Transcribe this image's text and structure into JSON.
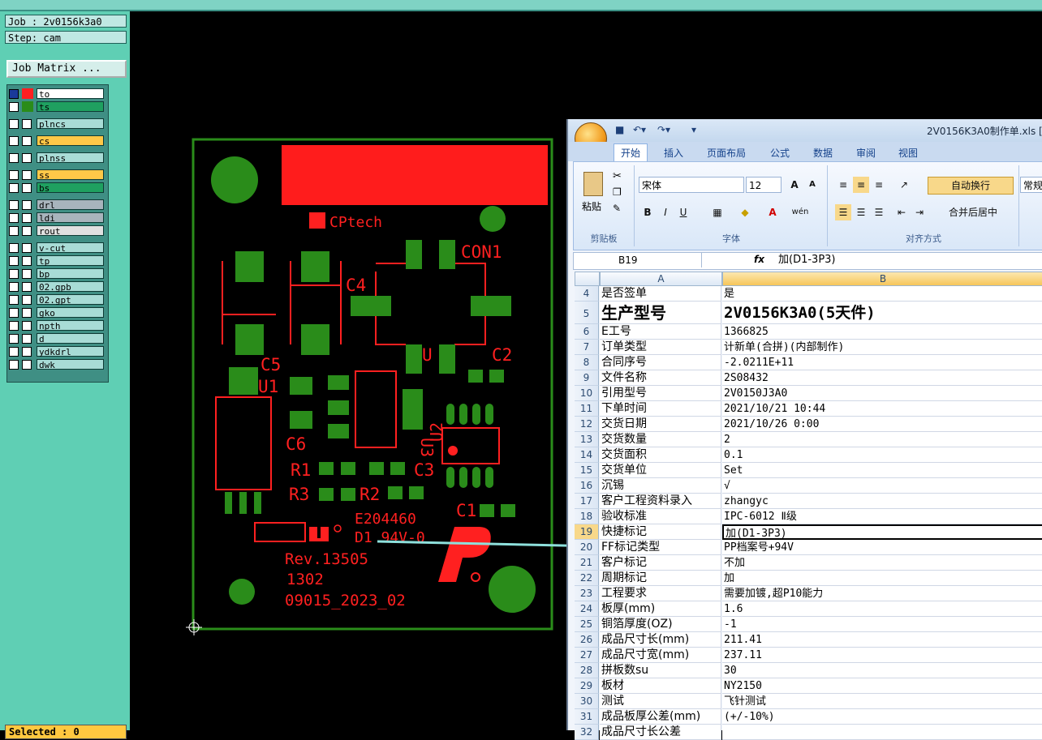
{
  "left_panel": {
    "job": "Job : 2v0156k3a0",
    "step": "Step: cam",
    "job_matrix_button": "Job Matrix ...",
    "selected": "Selected : 0",
    "layers": [
      {
        "name": "to",
        "color": "#ffffff"
      },
      {
        "name": "ts",
        "color": "#1fa060"
      },
      {
        "name": "plncs",
        "color": "#a8dcd6"
      },
      {
        "name": "cs",
        "color": "#ffc848"
      },
      {
        "name": "plnss",
        "color": "#a8dcd6"
      },
      {
        "name": "ss",
        "color": "#ffc848"
      },
      {
        "name": "bs",
        "color": "#1fa060"
      },
      {
        "name": "drl",
        "color": "#a8b4bc"
      },
      {
        "name": "ldi",
        "color": "#a8b4bc"
      },
      {
        "name": "rout",
        "color": "#e0e0e0"
      },
      {
        "name": "v-cut",
        "color": "#a8dcd6"
      },
      {
        "name": "tp",
        "color": "#a8dcd6"
      },
      {
        "name": "bp",
        "color": "#a8dcd6"
      },
      {
        "name": "02.gpb",
        "color": "#a8dcd6"
      },
      {
        "name": "02.gpt",
        "color": "#a8dcd6"
      },
      {
        "name": "gko",
        "color": "#a8dcd6"
      },
      {
        "name": "npth",
        "color": "#a8dcd6"
      },
      {
        "name": "d",
        "color": "#a8dcd6"
      },
      {
        "name": "ydkdrl",
        "color": "#a8dcd6"
      },
      {
        "name": "dwk",
        "color": "#a8dcd6"
      }
    ]
  },
  "pcb": {
    "logo": "CPtech",
    "labels": {
      "con1": "CON1",
      "c4": "C4",
      "c5": "C5",
      "u1": "U1",
      "c2": "C2",
      "c6": "C6",
      "u2": "U2",
      "u3": "U3",
      "r1": "R1",
      "c3": "C3",
      "r3": "R3",
      "r2": "R2",
      "c1": "C1",
      "u": "U"
    },
    "marking": [
      "E204460",
      "D1 94V-0"
    ],
    "rev": "Rev.13505",
    "date_code": "1302",
    "batch": "09015_2023_02"
  },
  "excel": {
    "title": "2V0156K3A0制作单.xls [",
    "tabs": [
      "开始",
      "插入",
      "页面布局",
      "公式",
      "数据",
      "审阅",
      "视图"
    ],
    "ribbon": {
      "paste": "粘贴",
      "clipboard": "剪贴板",
      "font_name": "宋体",
      "font_size": "12",
      "font_group": "字体",
      "wrap": "自动换行",
      "merge": "合并后居中",
      "align_group": "对齐方式",
      "number_format": "常规"
    },
    "name_box": "B19",
    "formula": "加(D1-3P3)",
    "col_a": "A",
    "col_b": "B",
    "rows": [
      {
        "n": "4",
        "a": "是否签单",
        "b": "是"
      },
      {
        "n": "5",
        "a": "生产型号",
        "b": "2V0156K3A0(5天件)"
      },
      {
        "n": "6",
        "a": "E工号",
        "b": "1366825"
      },
      {
        "n": "7",
        "a": "订单类型",
        "b": "计新单(合拼)(内部制作)"
      },
      {
        "n": "8",
        "a": "合同序号",
        "b": "-2.0211E+11"
      },
      {
        "n": "9",
        "a": "文件名称",
        "b": "2S08432"
      },
      {
        "n": "10",
        "a": "引用型号",
        "b": "2V0150J3A0"
      },
      {
        "n": "11",
        "a": "下单时间",
        "b": "2021/10/21 10:44"
      },
      {
        "n": "12",
        "a": "交货日期",
        "b": "2021/10/26 0:00"
      },
      {
        "n": "13",
        "a": "交货数量",
        "b": "2"
      },
      {
        "n": "14",
        "a": "交货面积",
        "b": "0.1"
      },
      {
        "n": "15",
        "a": "交货单位",
        "b": "Set"
      },
      {
        "n": "16",
        "a": "沉锡",
        "b": "√"
      },
      {
        "n": "17",
        "a": "客户工程资料录入",
        "b": "zhangyc"
      },
      {
        "n": "18",
        "a": "验收标准",
        "b": "IPC-6012 Ⅱ级"
      },
      {
        "n": "19",
        "a": "快捷标记",
        "b": "加(D1-3P3)"
      },
      {
        "n": "20",
        "a": "FF标记类型",
        "b": "PP档案号+94V"
      },
      {
        "n": "21",
        "a": "客户标记",
        "b": "不加"
      },
      {
        "n": "22",
        "a": "周期标记",
        "b": "加"
      },
      {
        "n": "23",
        "a": "工程要求",
        "b": "需要加镀,超P10能力"
      },
      {
        "n": "24",
        "a": "板厚(mm)",
        "b": "1.6"
      },
      {
        "n": "25",
        "a": "铜箔厚度(OZ)",
        "b": "-1"
      },
      {
        "n": "26",
        "a": "成品尺寸长(mm)",
        "b": "211.41"
      },
      {
        "n": "27",
        "a": "成品尺寸宽(mm)",
        "b": "237.11"
      },
      {
        "n": "28",
        "a": "拼板数su",
        "b": "30"
      },
      {
        "n": "29",
        "a": "板材",
        "b": "NY2150"
      },
      {
        "n": "30",
        "a": "测试",
        "b": "飞针测试"
      },
      {
        "n": "31",
        "a": "成品板厚公差(mm)",
        "b": "(+/-10%)"
      },
      {
        "n": "32",
        "a": "成品尺寸长公差",
        "b": ""
      }
    ]
  },
  "colors": {
    "pad": "#2a8c1a",
    "silk": "#ff2020",
    "panel": "#5fcfb4"
  }
}
